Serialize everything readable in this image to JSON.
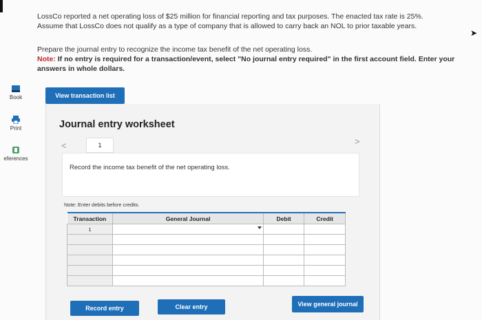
{
  "problem": {
    "line1": "LossCo reported a net operating loss of $25 million for financial reporting and tax purposes. The enacted tax rate is 25%.",
    "line2": "Assume that LossCo does not qualify as a type of company that is allowed to carry back an NOL to prior taxable years.",
    "instruction": "Prepare the journal entry to recognize the income tax benefit of the net operating loss.",
    "note_label": "Note:",
    "note_text": " If no entry is required for a transaction/event, select \"No journal entry required\" in the first account field. Enter your answers in whole dollars."
  },
  "sidebar": {
    "items": [
      {
        "label": "Book",
        "icon": "book-icon"
      },
      {
        "label": "Print",
        "icon": "printer-icon"
      },
      {
        "label": "eferences",
        "icon": "references-icon"
      }
    ]
  },
  "buttons": {
    "view_transaction_list": "View transaction list",
    "record_entry": "Record entry",
    "clear_entry": "Clear entry",
    "view_general_journal": "View general journal"
  },
  "worksheet": {
    "title": "Journal entry worksheet",
    "page": "1",
    "prev": "<",
    "next": ">",
    "record_instruction": "Record the income tax benefit of the net operating loss.",
    "debits_note": "Note: Enter debits before credits.",
    "columns": [
      "Transaction",
      "General Journal",
      "Debit",
      "Credit"
    ],
    "rows": [
      {
        "transaction": "1",
        "account": "",
        "debit": "",
        "credit": ""
      },
      {
        "transaction": "",
        "account": "",
        "debit": "",
        "credit": ""
      },
      {
        "transaction": "",
        "account": "",
        "debit": "",
        "credit": ""
      },
      {
        "transaction": "",
        "account": "",
        "debit": "",
        "credit": ""
      },
      {
        "transaction": "",
        "account": "",
        "debit": "",
        "credit": ""
      },
      {
        "transaction": "",
        "account": "",
        "debit": "",
        "credit": ""
      }
    ]
  },
  "colors": {
    "accent": "#1f6eb8",
    "note_red": "#c0282d"
  }
}
